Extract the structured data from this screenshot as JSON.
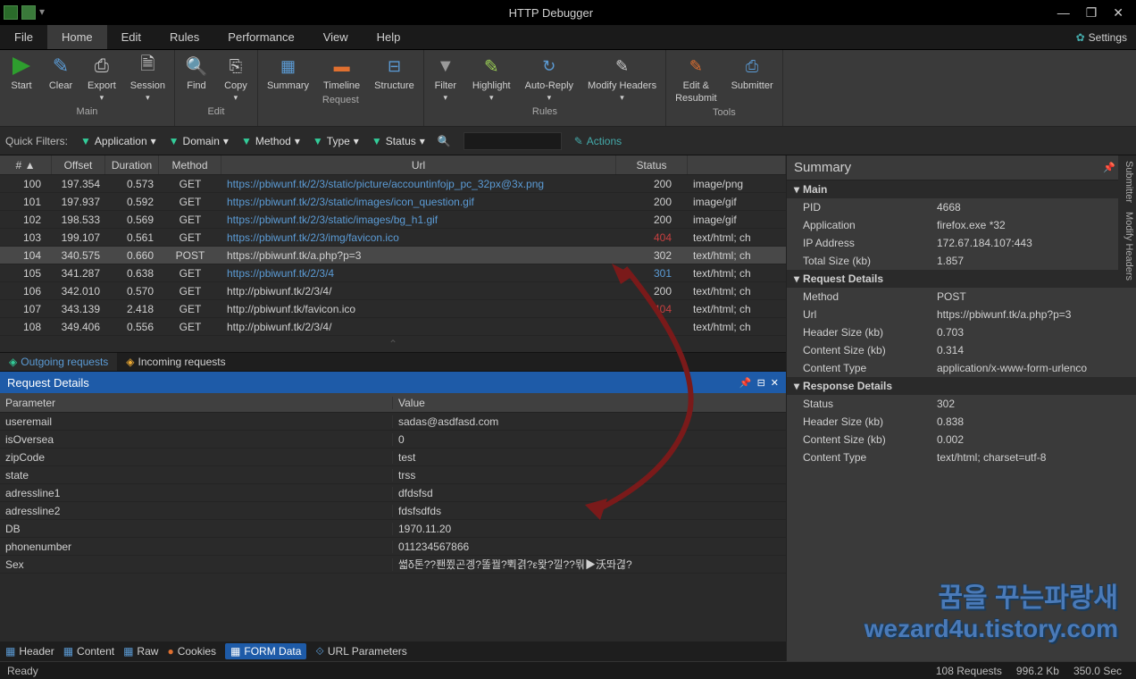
{
  "window": {
    "title": "HTTP Debugger"
  },
  "menubar": {
    "file": "File",
    "home": "Home",
    "edit": "Edit",
    "rules": "Rules",
    "performance": "Performance",
    "view": "View",
    "help": "Help",
    "settings": "Settings"
  },
  "ribbon": {
    "groups": {
      "main": {
        "label": "Main",
        "start": "Start",
        "clear": "Clear",
        "export": "Export",
        "session": "Session"
      },
      "edit": {
        "label": "Edit",
        "find": "Find",
        "copy": "Copy"
      },
      "request": {
        "label": "Request",
        "summary": "Summary",
        "timeline": "Timeline",
        "structure": "Structure"
      },
      "rules": {
        "label": "Rules",
        "filter": "Filter",
        "highlight": "Highlight",
        "autoreply": "Auto-Reply",
        "modifyheaders": "Modify Headers"
      },
      "tools": {
        "label": "Tools",
        "editresubmit1": "Edit &",
        "editresubmit2": "Resubmit",
        "submitter": "Submitter"
      }
    }
  },
  "filters": {
    "label": "Quick Filters:",
    "application": "Application",
    "domain": "Domain",
    "method": "Method",
    "type": "Type",
    "status": "Status",
    "actions": "Actions"
  },
  "grid": {
    "headers": {
      "num": "#",
      "offset": "Offset",
      "duration": "Duration",
      "method": "Method",
      "url": "Url",
      "status": "Status",
      "type": ""
    },
    "rows": [
      {
        "n": "100",
        "off": "197.354",
        "dur": "0.573",
        "m": "GET",
        "url": "https://pbiwunf.tk/2/3/static/picture/accountinfojp_pc_32px@3x.png",
        "s": "200",
        "st": "st200",
        "ty": "image/png",
        "plain": false
      },
      {
        "n": "101",
        "off": "197.937",
        "dur": "0.592",
        "m": "GET",
        "url": "https://pbiwunf.tk/2/3/static/images/icon_question.gif",
        "s": "200",
        "st": "st200",
        "ty": "image/gif",
        "plain": false
      },
      {
        "n": "102",
        "off": "198.533",
        "dur": "0.569",
        "m": "GET",
        "url": "https://pbiwunf.tk/2/3/static/images/bg_h1.gif",
        "s": "200",
        "st": "st200",
        "ty": "image/gif",
        "plain": false
      },
      {
        "n": "103",
        "off": "199.107",
        "dur": "0.561",
        "m": "GET",
        "url": "https://pbiwunf.tk/2/3/img/favicon.ico",
        "s": "404",
        "st": "st404",
        "ty": "text/html; ch",
        "plain": false
      },
      {
        "n": "104",
        "off": "340.575",
        "dur": "0.660",
        "m": "POST",
        "url": "https://pbiwunf.tk/a.php?p=3",
        "s": "302",
        "st": "st302",
        "ty": "text/html; ch",
        "plain": true,
        "sel": true
      },
      {
        "n": "105",
        "off": "341.287",
        "dur": "0.638",
        "m": "GET",
        "url": "https://pbiwunf.tk/2/3/4",
        "s": "301",
        "st": "st301",
        "ty": "text/html; ch",
        "plain": false
      },
      {
        "n": "106",
        "off": "342.010",
        "dur": "0.570",
        "m": "GET",
        "url": "http://pbiwunf.tk/2/3/4/",
        "s": "200",
        "st": "st200",
        "ty": "text/html; ch",
        "plain": true
      },
      {
        "n": "107",
        "off": "343.139",
        "dur": "2.418",
        "m": "GET",
        "url": "http://pbiwunf.tk/favicon.ico",
        "s": "404",
        "st": "st404",
        "ty": "text/html; ch",
        "plain": true
      },
      {
        "n": "108",
        "off": "349.406",
        "dur": "0.556",
        "m": "GET",
        "url": "http://pbiwunf.tk/2/3/4/",
        "s": "",
        "st": "st200",
        "ty": "text/html; ch",
        "plain": true
      }
    ]
  },
  "tabs": {
    "outgoing": "Outgoing requests",
    "incoming": "Incoming requests"
  },
  "request_details": {
    "title": "Request Details",
    "param_header": "Parameter",
    "value_header": "Value",
    "rows": [
      {
        "p": "useremail",
        "v": "sadas@asdfasd.com"
      },
      {
        "p": "isOversea",
        "v": "0"
      },
      {
        "p": "zipCode",
        "v": "test"
      },
      {
        "p": "state",
        "v": "trss"
      },
      {
        "p": "adressline1",
        "v": "dfdsfsd"
      },
      {
        "p": "adressline2",
        "v": "fdsfsdfds"
      },
      {
        "p": "DB",
        "v": "1970.11.20"
      },
      {
        "p": "phonenumber",
        "v": "011234567866"
      },
      {
        "p": "Sex",
        "v": "쎫δ톤??퐨쬤곤곙?똘꿜?쀡겱?ε뫛?낄??뭒▶沃똬겮?"
      }
    ],
    "tabs": {
      "header": "Header",
      "content": "Content",
      "raw": "Raw",
      "cookies": "Cookies",
      "formdata": "FORM Data",
      "urlparams": "URL Parameters"
    }
  },
  "summary": {
    "title": "Summary",
    "main_label": "Main",
    "main": {
      "PID": "4668",
      "Application": "firefox.exe *32",
      "IP Address": "172.67.184.107:443",
      "Total Size (kb)": "1.857"
    },
    "req_label": "Request Details",
    "req": {
      "Method": "POST",
      "Url": "https://pbiwunf.tk/a.php?p=3",
      "Header Size (kb)": "0.703",
      "Content Size (kb)": "0.314",
      "Content Type": "application/x-www-form-urlenco"
    },
    "resp_label": "Response Details",
    "resp": {
      "Status": "302",
      "Header Size (kb)": "0.838",
      "Content Size (kb)": "0.002",
      "Content Type": "text/html; charset=utf-8"
    }
  },
  "sidetabs": {
    "submitter": "Submitter",
    "modifyheaders": "Modify Headers"
  },
  "statusbar": {
    "ready": "Ready",
    "requests": "108 Requests",
    "size": "996.2 Kb",
    "time": "350.0 Sec"
  },
  "watermark": {
    "line1": "꿈을 꾸는파랑새",
    "line2": "wezard4u.tistory.com"
  }
}
